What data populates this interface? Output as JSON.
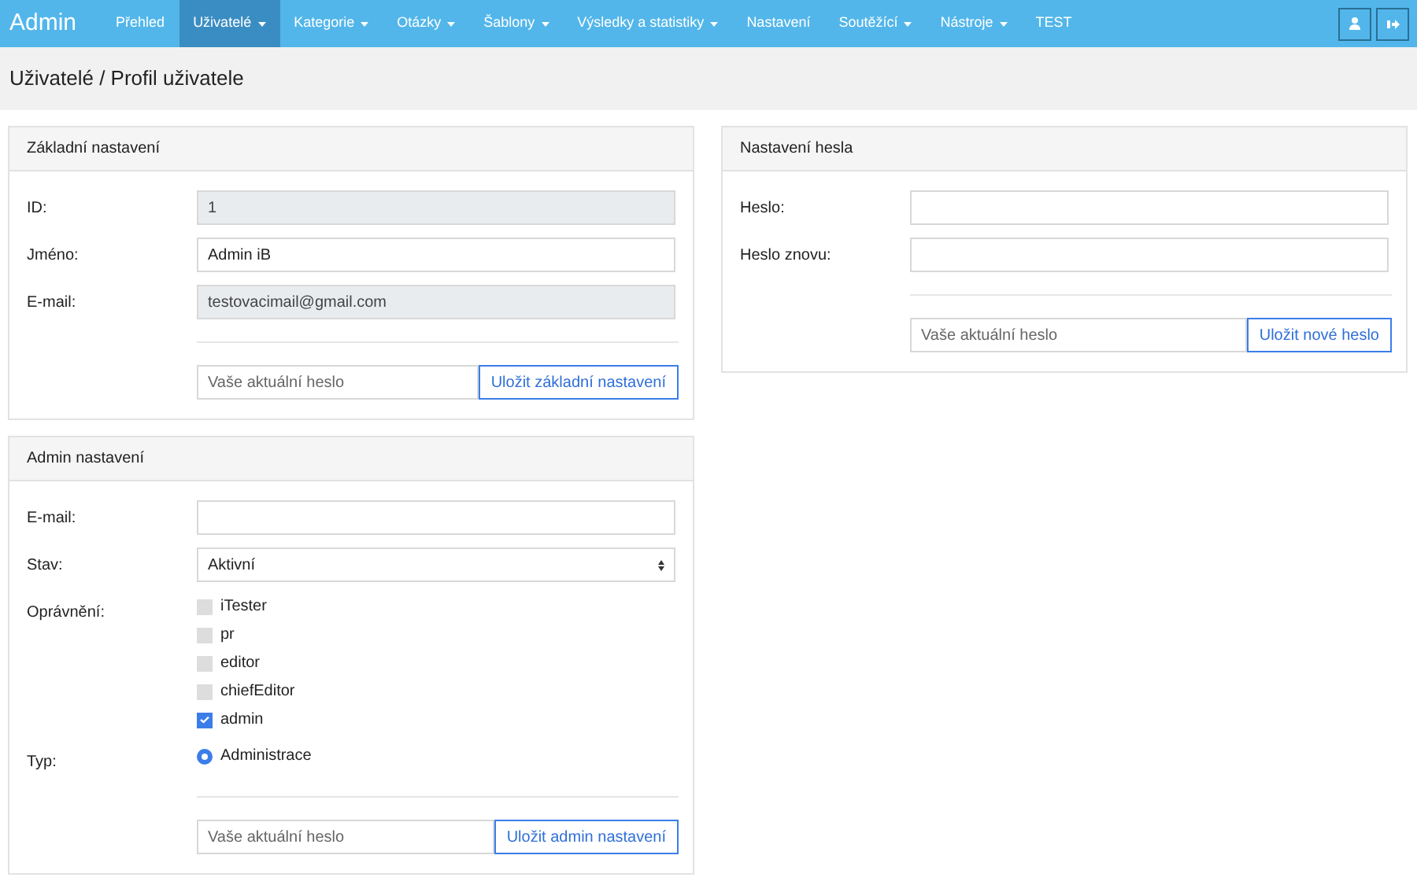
{
  "navbar": {
    "brand": "Admin",
    "items": [
      {
        "label": "Přehled",
        "dropdown": false,
        "selected": false
      },
      {
        "label": "Uživatelé",
        "dropdown": true,
        "selected": true
      },
      {
        "label": "Kategorie",
        "dropdown": true,
        "selected": false
      },
      {
        "label": "Otázky",
        "dropdown": true,
        "selected": false
      },
      {
        "label": "Šablony",
        "dropdown": true,
        "selected": false
      },
      {
        "label": "Výsledky a statistiky",
        "dropdown": true,
        "selected": false
      },
      {
        "label": "Nastavení",
        "dropdown": false,
        "selected": false
      },
      {
        "label": "Soutěžící",
        "dropdown": true,
        "selected": false
      },
      {
        "label": "Nástroje",
        "dropdown": true,
        "selected": false
      },
      {
        "label": "TEST",
        "dropdown": false,
        "selected": false
      }
    ]
  },
  "breadcrumb": "Uživatelé / Profil uživatele",
  "columns": [
    {
      "cards": [
        {
          "title": "Základní nastavení",
          "fields": [
            {
              "kind": "input",
              "label": "ID:",
              "value": "1",
              "disabled": true
            },
            {
              "kind": "input",
              "label": "Jméno:",
              "value": "Admin iB",
              "disabled": false
            },
            {
              "kind": "input",
              "label": "E-mail:",
              "value": "testovacimail@gmail.com",
              "disabled": true
            }
          ],
          "footer": {
            "placeholder": "Vaše aktuální heslo",
            "button": "Uložit základní nastavení"
          }
        },
        {
          "title": "Admin nastavení",
          "fields": [
            {
              "kind": "input",
              "label": "E-mail:",
              "disabled": false
            },
            {
              "kind": "select",
              "label": "Stav:",
              "value": "Aktivní"
            },
            {
              "kind": "checkboxes",
              "label": "Oprávnění:",
              "options": [
                {
                  "label": "iTester",
                  "checked": false
                },
                {
                  "label": "pr",
                  "checked": false
                },
                {
                  "label": "editor",
                  "checked": false
                },
                {
                  "label": "chiefEditor",
                  "checked": false
                },
                {
                  "label": "admin",
                  "checked": true
                }
              ]
            },
            {
              "kind": "radios",
              "label": "Typ:",
              "options": [
                {
                  "label": "Administrace",
                  "selected": true
                }
              ]
            }
          ],
          "footer": {
            "placeholder": "Vaše aktuální heslo",
            "button": "Uložit admin nastavení"
          }
        }
      ]
    },
    {
      "cards": [
        {
          "title": "Nastavení hesla",
          "fields": [
            {
              "kind": "input",
              "label": "Heslo:",
              "disabled": false
            },
            {
              "kind": "input",
              "label": "Heslo znovu:",
              "disabled": false
            }
          ],
          "footer": {
            "placeholder": "Vaše aktuální heslo",
            "button": "Uložit nové heslo"
          }
        }
      ]
    }
  ]
}
